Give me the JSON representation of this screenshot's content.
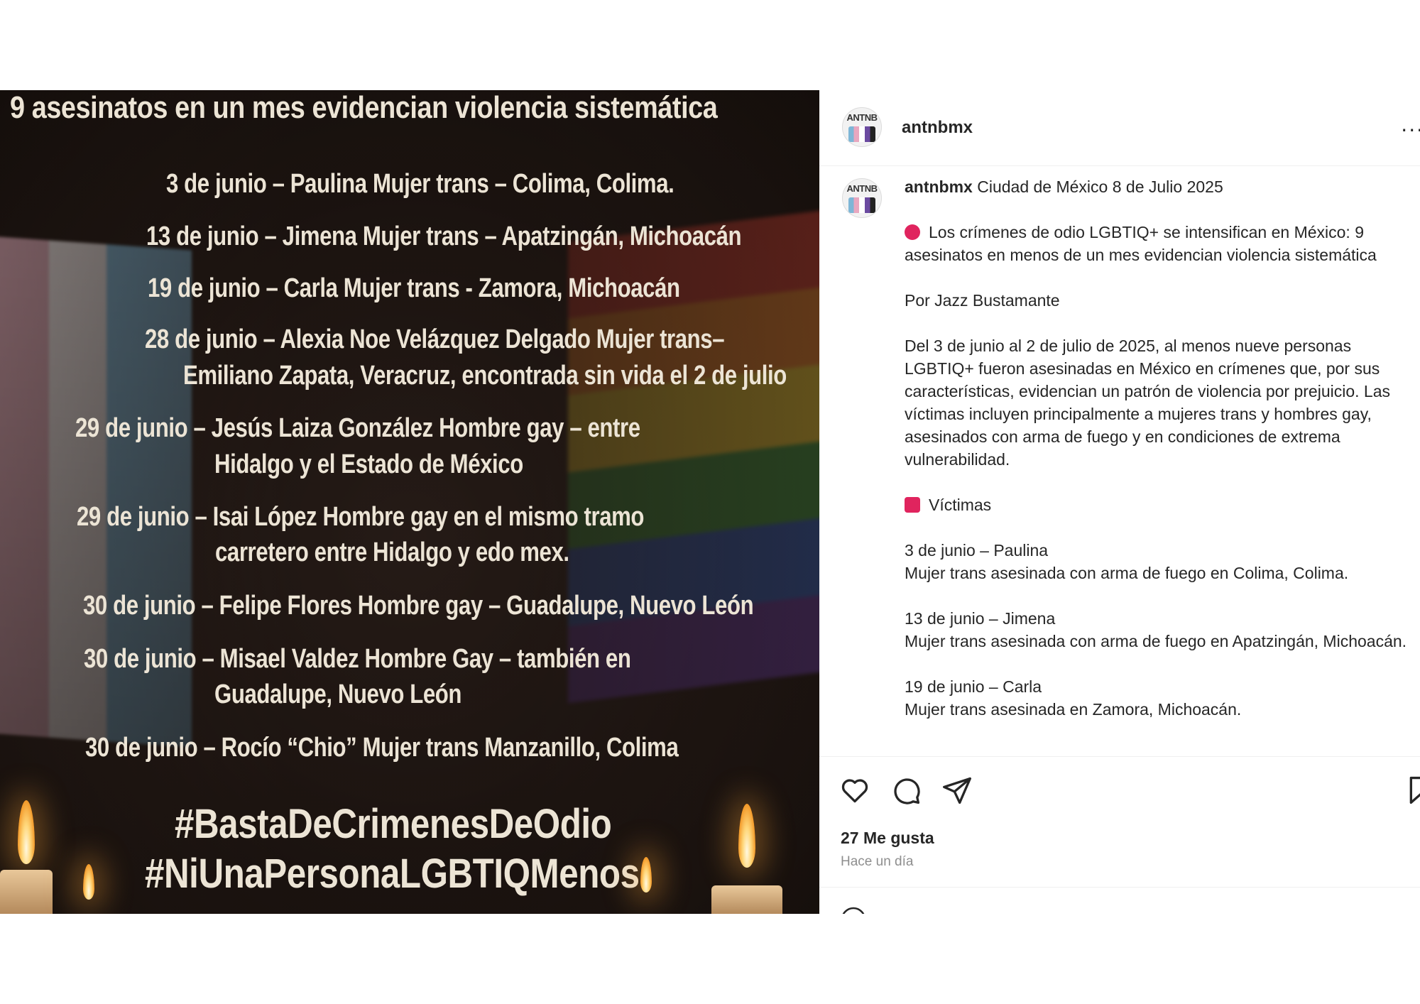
{
  "image": {
    "title": "9 asesinatos en un mes evidencian violencia sistemática",
    "victims": [
      {
        "line1": "3 de junio – Paulina Mujer trans – Colima, Colima.",
        "line2": ""
      },
      {
        "line1": "13 de junio – Jimena Mujer trans –  Apatzingán, Michoacán",
        "line2": ""
      },
      {
        "line1": "19 de junio – Carla Mujer trans - Zamora, Michoacán",
        "line2": ""
      },
      {
        "line1": "28 de junio – Alexia Noe Velázquez Delgado Mujer trans–",
        "line2": "Emiliano Zapata, Veracruz, encontrada sin vida el 2 de julio"
      },
      {
        "line1": "29 de junio – Jesús Laiza González Hombre gay – entre",
        "line2": "Hidalgo y el Estado de México"
      },
      {
        "line1": "29 de junio – Isai López Hombre gay en el mismo tramo",
        "line2": "carretero entre Hidalgo y edo mex."
      },
      {
        "line1": "30 de junio – Felipe Flores Hombre gay – Guadalupe, Nuevo León",
        "line2": ""
      },
      {
        "line1": "30 de junio – Misael Valdez Hombre Gay – también en",
        "line2": "Guadalupe, Nuevo León"
      },
      {
        "line1": "30 de junio – Rocío “Chio” Mujer trans Manzanillo, Colima",
        "line2": ""
      }
    ],
    "hashtag1": "#BastaDeCrimenesDeOdio",
    "hashtag2": "#NiUnaPersonaLGBTIQMenos",
    "avatar_text": "ANTNB"
  },
  "header": {
    "username": "antnbmx",
    "more": "···"
  },
  "caption": {
    "username": "antnbmx",
    "location_date": "Ciudad de México 8 de Julio 2025",
    "headline": "Los crímenes de odio LGBTIQ+ se intensifican en México: 9 asesinatos en menos de un mes evidencian violencia sistemática",
    "byline": "Por Jazz Bustamante",
    "body": "Del 3 de junio al 2 de julio de 2025, al menos nueve personas LGBTIQ+ fueron asesinadas en México en crímenes que, por sus características, evidencian un patrón de violencia por prejuicio. Las víctimas incluyen principalmente a mujeres trans y hombres gay, asesinados con arma de fuego y en condiciones de extrema vulnerabilidad.",
    "victims_heading": "Víctimas",
    "entries": [
      {
        "title": "3 de junio – Paulina",
        "desc": "Mujer trans asesinada con arma de fuego en Colima, Colima."
      },
      {
        "title": "13 de junio – Jimena",
        "desc": "Mujer trans asesinada con arma de fuego en Apatzingán, Michoacán."
      },
      {
        "title": "19 de junio – Carla",
        "desc": "Mujer trans asesinada en Zamora, Michoacán."
      }
    ]
  },
  "footer": {
    "likes": "27 Me gusta",
    "time_ago": "Hace un día"
  },
  "icons": {
    "like": "heart-icon",
    "comment": "comment-icon",
    "share": "send-icon",
    "save": "bookmark-icon",
    "more": "more-options-icon"
  },
  "colors": {
    "emoji_red": "#e0245e",
    "image_text": "#ece4d5",
    "muted": "#8e8e8e"
  }
}
